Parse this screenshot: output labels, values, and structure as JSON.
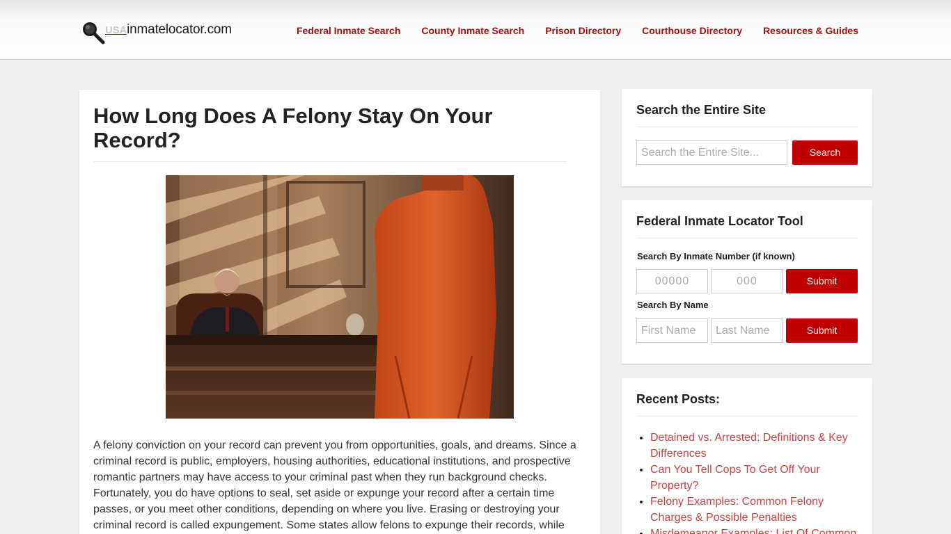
{
  "logo": {
    "usa": "USA",
    "name": "inmatelocator.com"
  },
  "nav": [
    "Federal Inmate Search",
    "County Inmate Search",
    "Prison Directory",
    "Courthouse Directory",
    "Resources & Guides"
  ],
  "article": {
    "title": "How Long Does A Felony Stay On Your Record?",
    "body": "A felony conviction on your record can prevent you from opportunities, goals, and dreams. Since a criminal record is public, employers, housing authorities, educational institutions, and prospective romantic partners may have access to your criminal past when they run background checks. Fortunately, you do have options to seal, set aside or expunge your record after a certain time passes, or you meet other conditions, depending on where you live. Erasing or destroying your criminal record is called expungement. Some states allow felons to expunge their records, while"
  },
  "search_widget": {
    "title": "Search the Entire Site",
    "placeholder": "Search the Entire Site...",
    "button": "Search"
  },
  "locator_widget": {
    "title": "Federal Inmate Locator Tool",
    "by_number_label": "Search By Inmate Number (if known)",
    "number_placeholder_1": "00000",
    "number_placeholder_2": "000",
    "by_name_label": "Search By Name",
    "first_placeholder": "First Name",
    "last_placeholder": "Last Name",
    "submit": "Submit"
  },
  "recent_widget": {
    "title": "Recent Posts:",
    "posts": [
      "Detained vs. Arrested: Definitions & Key Differences",
      "Can You Tell Cops To Get Off Your Property?",
      "Felony Examples: Common Felony Charges & Possible Penalties",
      "Misdemeanor Examples: List Of Common"
    ]
  },
  "colors": {
    "accent": "#c00000",
    "nav_link": "#a10e0e",
    "post_link": "#c84444"
  }
}
